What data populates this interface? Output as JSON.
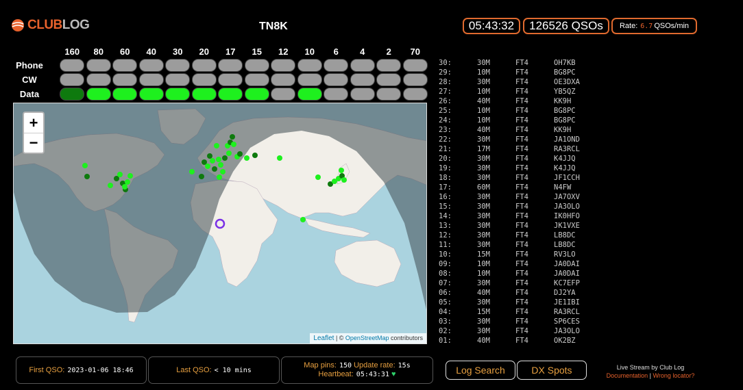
{
  "header": {
    "logo_club": "CLUB",
    "logo_log": "LOG",
    "callsign": "TN8K",
    "clock": "05:43:32",
    "qsos": "126526 QSOs",
    "rate_label": "Rate:",
    "rate_value": "6.7",
    "rate_unit": "QSOs/min"
  },
  "bands": [
    "160",
    "80",
    "60",
    "40",
    "30",
    "20",
    "17",
    "15",
    "12",
    "10",
    "6",
    "4",
    "2",
    "70"
  ],
  "modes": [
    {
      "label": "Phone",
      "states": [
        "off",
        "off",
        "off",
        "off",
        "off",
        "off",
        "off",
        "off",
        "off",
        "off",
        "off",
        "off",
        "off",
        "off"
      ]
    },
    {
      "label": "CW",
      "states": [
        "off",
        "off",
        "off",
        "off",
        "off",
        "off",
        "off",
        "off",
        "off",
        "off",
        "off",
        "off",
        "off",
        "off"
      ]
    },
    {
      "label": "Data",
      "states": [
        "dark",
        "on",
        "on",
        "on",
        "on",
        "on",
        "on",
        "on",
        "off",
        "on",
        "off",
        "off",
        "off",
        "off"
      ]
    }
  ],
  "map": {
    "zoom_in": "+",
    "zoom_out": "−",
    "attribution_leaflet": "Leaflet",
    "attribution_sep": " | © ",
    "attribution_osm": "OpenStreetMap",
    "attribution_contrib": " contributors"
  },
  "log": [
    {
      "n": "30:",
      "band": "30M",
      "mode": "FT4",
      "call": "OH7KB"
    },
    {
      "n": "29:",
      "band": "10M",
      "mode": "FT4",
      "call": "BG8PC"
    },
    {
      "n": "28:",
      "band": "30M",
      "mode": "FT4",
      "call": "OE3DXA"
    },
    {
      "n": "27:",
      "band": "10M",
      "mode": "FT4",
      "call": "YB5QZ"
    },
    {
      "n": "26:",
      "band": "40M",
      "mode": "FT4",
      "call": "KK9H"
    },
    {
      "n": "25:",
      "band": "10M",
      "mode": "FT4",
      "call": "BG8PC"
    },
    {
      "n": "24:",
      "band": "10M",
      "mode": "FT4",
      "call": "BG8PC"
    },
    {
      "n": "23:",
      "band": "40M",
      "mode": "FT4",
      "call": "KK9H"
    },
    {
      "n": "22:",
      "band": "30M",
      "mode": "FT4",
      "call": "JA1OND"
    },
    {
      "n": "21:",
      "band": "17M",
      "mode": "FT4",
      "call": "RA3RCL"
    },
    {
      "n": "20:",
      "band": "30M",
      "mode": "FT4",
      "call": "K4JJQ"
    },
    {
      "n": "19:",
      "band": "30M",
      "mode": "FT4",
      "call": "K4JJQ"
    },
    {
      "n": "18:",
      "band": "30M",
      "mode": "FT4",
      "call": "JF1CCH"
    },
    {
      "n": "17:",
      "band": "60M",
      "mode": "FT4",
      "call": "N4FW"
    },
    {
      "n": "16:",
      "band": "30M",
      "mode": "FT4",
      "call": "JA7OXV"
    },
    {
      "n": "15:",
      "band": "30M",
      "mode": "FT4",
      "call": "JA3OLO"
    },
    {
      "n": "14:",
      "band": "30M",
      "mode": "FT4",
      "call": "IK0HFO"
    },
    {
      "n": "13:",
      "band": "30M",
      "mode": "FT4",
      "call": "JK1VXE"
    },
    {
      "n": "12:",
      "band": "30M",
      "mode": "FT4",
      "call": "LB8DC"
    },
    {
      "n": "11:",
      "band": "30M",
      "mode": "FT4",
      "call": "LB8DC"
    },
    {
      "n": "10:",
      "band": "15M",
      "mode": "FT4",
      "call": "RV3LO"
    },
    {
      "n": "09:",
      "band": "10M",
      "mode": "FT4",
      "call": "JA0DAI"
    },
    {
      "n": "08:",
      "band": "10M",
      "mode": "FT4",
      "call": "JA0DAI"
    },
    {
      "n": "07:",
      "band": "30M",
      "mode": "FT4",
      "call": "KC7EFP"
    },
    {
      "n": "06:",
      "band": "40M",
      "mode": "FT4",
      "call": "DJ2YA"
    },
    {
      "n": "05:",
      "band": "30M",
      "mode": "FT4",
      "call": "JE1IBI"
    },
    {
      "n": "04:",
      "band": "15M",
      "mode": "FT4",
      "call": "RA3RCL"
    },
    {
      "n": "03:",
      "band": "30M",
      "mode": "FT4",
      "call": "SP6CES"
    },
    {
      "n": "02:",
      "band": "30M",
      "mode": "FT4",
      "call": "JA3OLO"
    },
    {
      "n": "01:",
      "band": "40M",
      "mode": "FT4",
      "call": "OK2BZ"
    }
  ],
  "footer": {
    "first_qso_label": "First QSO:",
    "first_qso_value": "2023-01-06 18:46",
    "last_qso_label": "Last QSO:",
    "last_qso_value": "< 10 mins",
    "map_pins_label": "Map pins:",
    "map_pins_value": "150",
    "update_rate_label": "Update rate:",
    "update_rate_value": "15s",
    "heartbeat_label": "Heartbeat:",
    "heartbeat_value": "05:43:31",
    "heart": "♥",
    "log_search": "Log Search",
    "dx_spots": "DX Spots",
    "live_stream": "Live Stream by Club Log",
    "documentation": "Documentation",
    "sep": " | ",
    "wrong_locator": "Wrong locator?"
  },
  "colors": {
    "accent": "#e8622c",
    "band_on": "#1ef01e",
    "band_dark": "#0e7a0e",
    "band_off": "#9c9c9c",
    "ocean": "#aad3df",
    "land": "#f2efe9",
    "night": "#5a6a70"
  }
}
